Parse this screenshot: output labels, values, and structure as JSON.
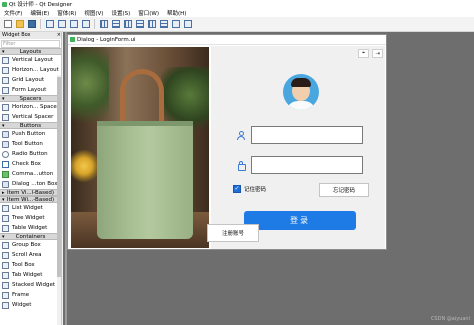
{
  "window": {
    "title": "Qt 设计师 - Qt Designer"
  },
  "menubar": [
    {
      "label": "文件(F)"
    },
    {
      "label": "编辑(E)"
    },
    {
      "label": "窗体(R)"
    },
    {
      "label": "视图(V)"
    },
    {
      "label": "设置(S)"
    },
    {
      "label": "窗口(W)"
    },
    {
      "label": "帮助(H)"
    }
  ],
  "toolbar": {
    "buttons": [
      {
        "icon": "new-file-icon"
      },
      {
        "icon": "open-folder-icon"
      },
      {
        "icon": "save-icon"
      },
      {
        "icon": "edit-widgets-icon"
      },
      {
        "icon": "edit-signals-icon"
      },
      {
        "icon": "edit-buddies-icon"
      },
      {
        "icon": "edit-taborder-icon"
      },
      {
        "icon": "layout-horizontal-icon"
      },
      {
        "icon": "layout-vertical-icon"
      },
      {
        "icon": "layout-splitter-h-icon"
      },
      {
        "icon": "layout-splitter-v-icon"
      },
      {
        "icon": "layout-grid-icon"
      },
      {
        "icon": "layout-form-icon"
      },
      {
        "icon": "break-layout-icon"
      },
      {
        "icon": "adjust-size-icon"
      }
    ]
  },
  "widgetbox": {
    "title": "Widget Box",
    "filter_placeholder": "Filter",
    "sections": [
      {
        "name": "Layouts",
        "items": [
          "Vertical Layout",
          "Horizon... Layout",
          "Grid Layout",
          "Form Layout"
        ]
      },
      {
        "name": "Spacers",
        "items": [
          "Horizon... Spacer",
          "Vertical Spacer"
        ]
      },
      {
        "name": "Buttons",
        "items": [
          "Push Button",
          "Tool Button",
          "Radio Button",
          "Check Box",
          "Comma...utton",
          "Dialog ...ton Box"
        ]
      },
      {
        "name": "Item Vi...l-Based)",
        "items": []
      },
      {
        "name": "Item Wi...-Based)",
        "items": [
          "List Widget",
          "Tree Widget",
          "Table Widget"
        ]
      },
      {
        "name": "Containers",
        "items": [
          "Group Box",
          "Scroll Area",
          "Tool Box",
          "Tab Widget",
          "Stacked Widget",
          "Frame",
          "Widget"
        ]
      }
    ]
  },
  "dialog": {
    "title": "Dialog - LoginForm.ui",
    "username_value": "",
    "password_value": "",
    "remember_label": "记住密码",
    "remember_checked": true,
    "forgot_label": "忘记密码",
    "login_label": "登录",
    "register_label": "注册账号",
    "pin_btn": "⌖",
    "exit_btn": "⇥"
  },
  "colors": {
    "accent": "#1e7be6"
  },
  "watermark": "CSDN @aiyuanl"
}
